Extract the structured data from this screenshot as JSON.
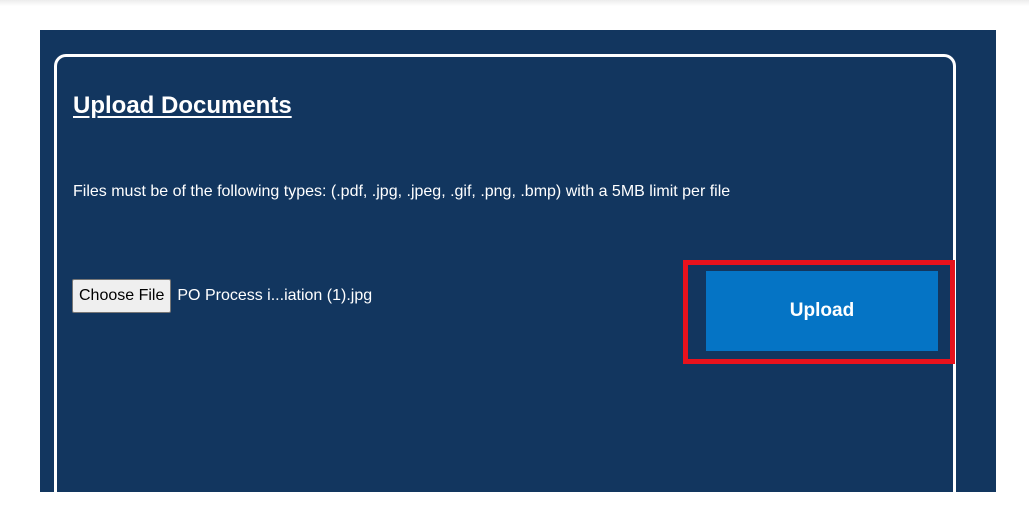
{
  "upload": {
    "title": "Upload Documents",
    "description": "Files must be of the following types: (.pdf, .jpg, .jpeg, .gif, .png, .bmp) with a 5MB limit per file",
    "choose_file_label": "Choose File",
    "selected_file_name": "PO Process i...iation (1).jpg",
    "upload_label": "Upload"
  },
  "colors": {
    "panel_background": "#12365f",
    "upload_button": "#0574c5",
    "highlight_border": "#e8121c"
  }
}
